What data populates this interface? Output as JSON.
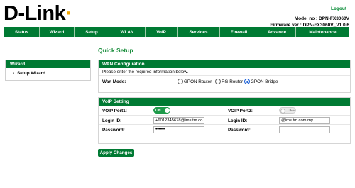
{
  "brand": {
    "logo_text": "D-Link"
  },
  "header": {
    "logout_label": "Logout",
    "model_text": "Model no : DPN-FX3060V",
    "firmware_text": "Firmware ver : DPN-FX3060V_V1.0.6"
  },
  "nav": [
    {
      "label": "Status"
    },
    {
      "label": "Wizard"
    },
    {
      "label": "Setup"
    },
    {
      "label": "WLAN"
    },
    {
      "label": "VoIP"
    },
    {
      "label": "Services"
    },
    {
      "label": "Firewall"
    },
    {
      "label": "Advance"
    },
    {
      "label": "Maintenance"
    }
  ],
  "sidebar": {
    "title": "Wizard",
    "items": [
      {
        "label": "Setup Wizard"
      }
    ]
  },
  "page": {
    "title": "Quick Setup"
  },
  "wan": {
    "title": "WAN Configuration",
    "description": "Please enter the required information below.",
    "mode_label": "Wan Mode:",
    "options": [
      {
        "label": "GPON Router",
        "selected": false
      },
      {
        "label": "RG Router",
        "selected": false
      },
      {
        "label": "GPON Bridge",
        "selected": true
      }
    ]
  },
  "voip": {
    "title": "VoIP Setting",
    "port1": {
      "label": "VOIP Port1:",
      "toggle_text": "ON",
      "enabled": true,
      "login_label": "Login ID:",
      "login_value": "+6012345678@ims.tm.co",
      "password_label": "Password:",
      "password_value": "•••••••"
    },
    "port2": {
      "label": "VOIP Port2:",
      "toggle_text": "OFF",
      "enabled": false,
      "login_label": "Login ID:",
      "login_value": "@ims.tm.com.my",
      "password_label": "Password:",
      "password_value": ""
    }
  },
  "actions": {
    "apply_label": "Apply Changes"
  },
  "colors": {
    "accent": "#007a33",
    "title_green": "#1d8f3f",
    "radio_selected": "#1a5fd6"
  }
}
